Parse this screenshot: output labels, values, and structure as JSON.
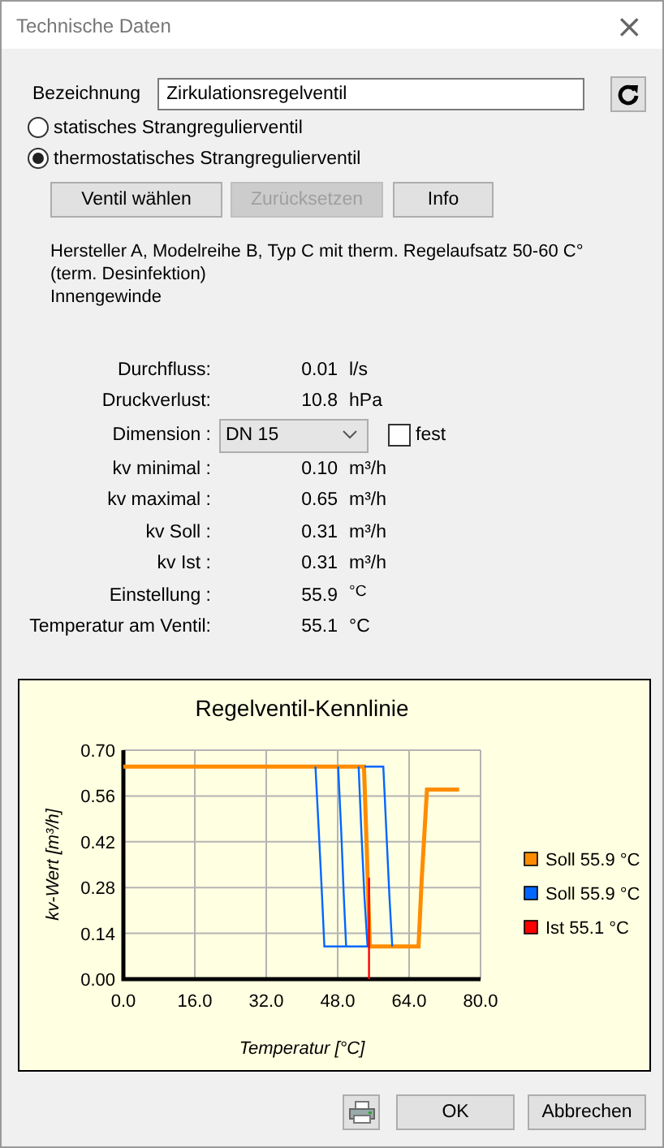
{
  "window": {
    "title": "Technische Daten",
    "close": "×"
  },
  "designation": {
    "label": "Bezeichnung",
    "value": "Zirkulationsregelventil"
  },
  "valve_types": [
    {
      "label": "statisches Strangregulierventil",
      "selected": false
    },
    {
      "label": "thermostatisches Strangregulierventil",
      "selected": true
    }
  ],
  "buttons": [
    {
      "label": "Ventil wählen",
      "disabled": false
    },
    {
      "label": "Zurücksetzen",
      "disabled": true
    },
    {
      "label": "Info",
      "disabled": false
    }
  ],
  "description": [
    "Hersteller A, Modelreihe B, Typ C mit therm. Regelaufsatz 50-60 C°",
    "(term. Desinfektion)",
    "Innengewinde"
  ],
  "values": [
    {
      "kind": "value",
      "label": "Durchfluss:",
      "value": "0.01",
      "unit": "l/s"
    },
    {
      "kind": "value",
      "label": "Druckverlust:",
      "value": "10.8",
      "unit": "hPa"
    },
    {
      "kind": "select",
      "label": "Dimension :",
      "value": "DN 15",
      "checkbox_label": "fest",
      "checked": false
    },
    {
      "kind": "value",
      "label": "kv minimal :",
      "value": "0.10",
      "unit": "m³/h"
    },
    {
      "kind": "value",
      "label": "kv maximal :",
      "value": "0.65",
      "unit": "m³/h"
    },
    {
      "kind": "value",
      "label": "kv Soll :",
      "value": "0.31",
      "unit": "m³/h"
    },
    {
      "kind": "value",
      "label": "kv Ist :",
      "value": "0.31",
      "unit": "m³/h"
    },
    {
      "kind": "value",
      "label": "Einstellung :",
      "value": "55.9",
      "unit": "$^{°C}$"
    },
    {
      "kind": "value",
      "label": "Temperatur am Ventil:",
      "value": "55.1",
      "unit": "°C"
    }
  ],
  "chart": {
    "chart_data": {
      "type": "line",
      "grid": true,
      "legend": "right",
      "title": "Regelventil-Kennlinie",
      "xlabel": "Temperatur [°C]",
      "ylabel": "kv-Wert [m³/h]",
      "xlim": [
        0,
        80
      ],
      "ylim": [
        0,
        0.7
      ],
      "xticks": [
        {
          "value": 0,
          "label": "0.0"
        },
        {
          "value": 16,
          "label": "16.0"
        },
        {
          "value": 32,
          "label": "32.0"
        },
        {
          "value": 48,
          "label": "48.0"
        },
        {
          "value": 64,
          "label": "64.0"
        },
        {
          "value": 80,
          "label": "80.0"
        }
      ],
      "yticks": [
        {
          "value": 0,
          "label": "0.00"
        },
        {
          "value": 0.14,
          "label": "0.14"
        },
        {
          "value": 0.28,
          "label": "0.28"
        },
        {
          "value": 0.42,
          "label": "0.42"
        },
        {
          "value": 0.56,
          "label": "0.56"
        },
        {
          "value": 0.7,
          "label": "0.70"
        }
      ],
      "series": [
        {
          "name": "Soll 55.9 °C",
          "color": "#ff8c00",
          "x": [
            0,
            53.9,
            54.5,
            55.2,
            66.1,
            66.8,
            68,
            75.2
          ],
          "values": [
            0.65,
            0.65,
            0.4,
            0.1,
            0.1,
            0.3,
            0.58,
            0.58
          ]
        },
        {
          "name": "Soll 55.9 °C",
          "color": "#0066ff",
          "x": [
            43,
            43.8,
            44.5,
            45,
            55,
            null,
            48.1,
            48.8,
            49.4,
            49.9,
            null,
            52.7,
            53.3,
            54,
            54.7,
            null,
            54,
            58.2,
            58.9,
            59.6,
            60.2
          ],
          "values": [
            0.65,
            0.45,
            0.25,
            0.1,
            0.1,
            null,
            0.65,
            0.45,
            0.25,
            0.1,
            null,
            0.65,
            0.45,
            0.25,
            0.1,
            null,
            0.65,
            0.65,
            0.45,
            0.25,
            0.1
          ]
        },
        {
          "name": "Ist 55.1 °C",
          "color": "#ff0000",
          "x": [
            55,
            55
          ],
          "values": [
            0,
            0.31
          ]
        }
      ]
    }
  },
  "footer": {
    "buttons": [
      "OK",
      "Abbrechen"
    ]
  }
}
